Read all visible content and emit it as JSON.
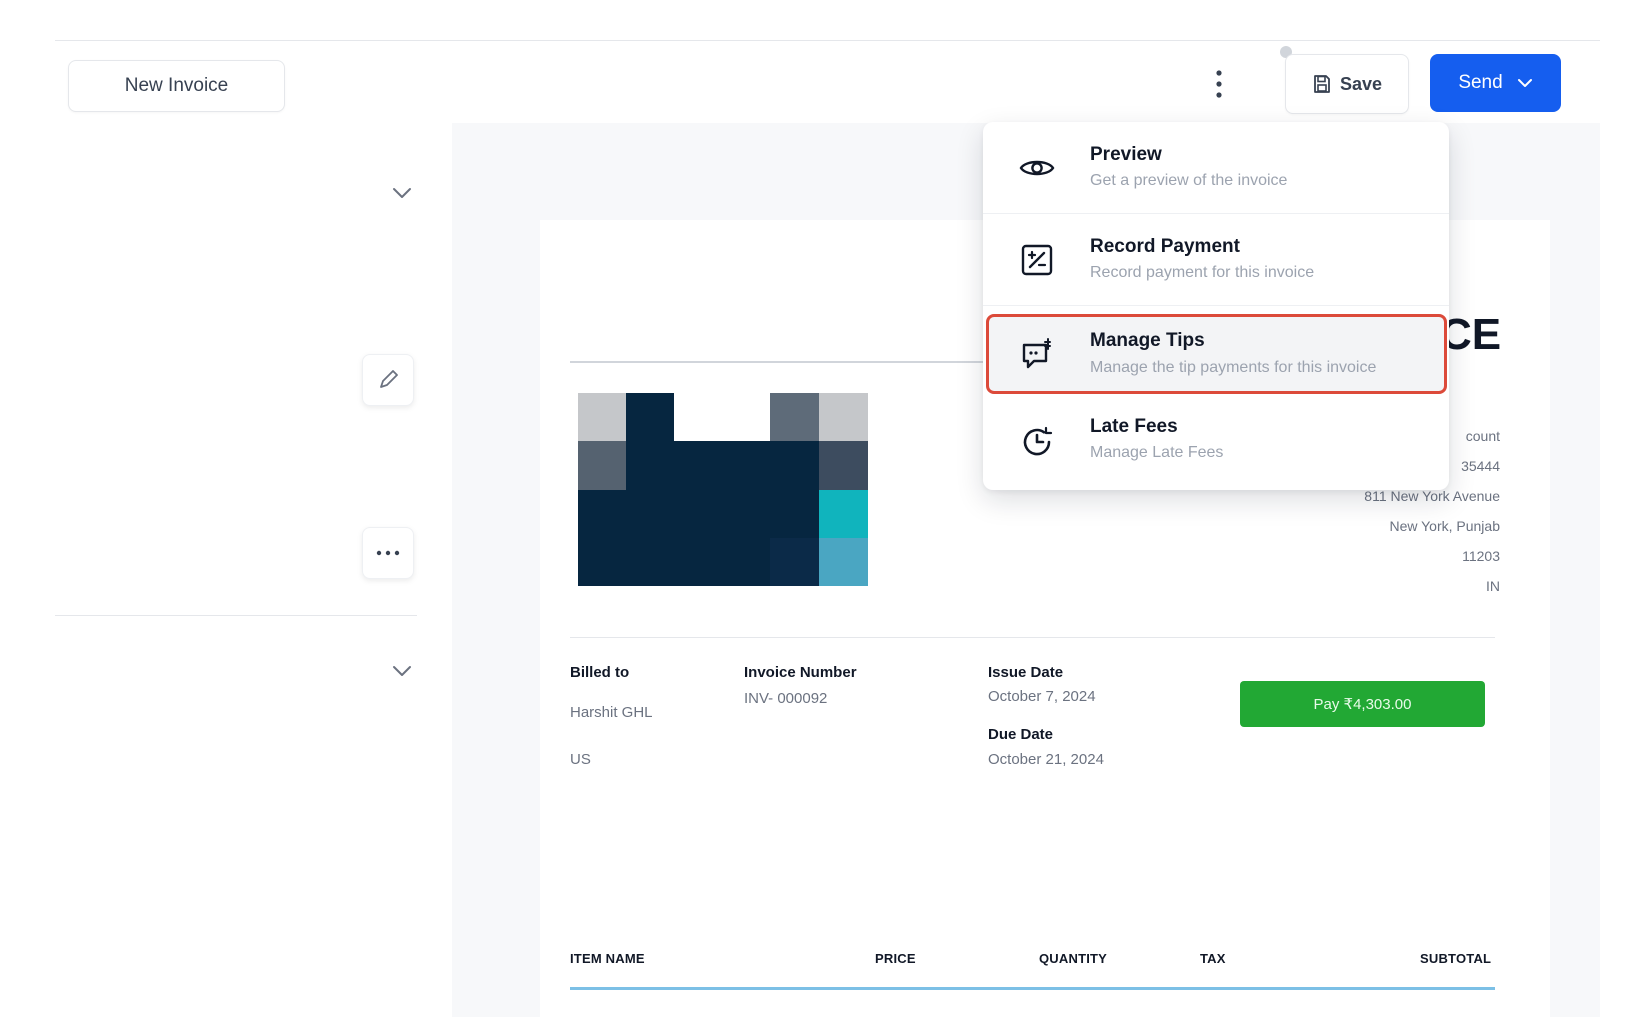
{
  "header": {
    "new_invoice_label": "New Invoice",
    "save_label": "Save",
    "send_label": "Send"
  },
  "menu": {
    "items": [
      {
        "title": "Preview",
        "description": "Get a preview of the invoice",
        "icon": "eye-icon"
      },
      {
        "title": "Record Payment",
        "description": "Record payment for this invoice",
        "icon": "payment-icon"
      },
      {
        "title": "Manage Tips",
        "description": "Manage the tip payments for this invoice",
        "icon": "tips-icon"
      },
      {
        "title": "Late Fees",
        "description": "Manage Late Fees",
        "icon": "clock-icon"
      }
    ],
    "highlighted_item": "Manage Tips"
  },
  "invoice": {
    "title_partial": "CE",
    "business_address": [
      "count",
      "35444",
      "811 New York Avenue",
      "New York, Punjab",
      "11203",
      "IN"
    ],
    "billed_to_label": "Billed to",
    "billed_to_name": "Harshit GHL",
    "billed_to_country": "US",
    "invoice_number_label": "Invoice Number",
    "invoice_number": "INV- 000092",
    "issue_date_label": "Issue Date",
    "issue_date": "October 7, 2024",
    "due_date_label": "Due Date",
    "due_date": "October 21, 2024",
    "pay_button_label": "Pay ₹4,303.00",
    "table_headers": [
      "ITEM NAME",
      "PRICE",
      "QUANTITY",
      "TAX",
      "SUBTOTAL"
    ]
  },
  "colors": {
    "primary": "#155eef",
    "pay_green": "#22a834",
    "highlight_border": "#dc4a3a"
  }
}
